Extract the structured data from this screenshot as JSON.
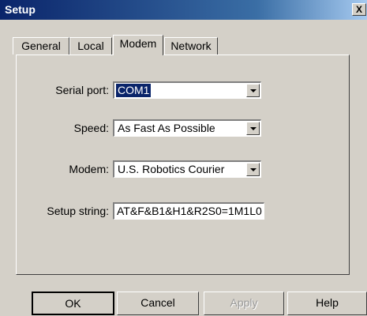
{
  "window": {
    "title": "Setup",
    "close_glyph": "X"
  },
  "tabs": [
    {
      "label": "General",
      "active": false
    },
    {
      "label": "Local",
      "active": false
    },
    {
      "label": "Modem",
      "active": true
    },
    {
      "label": "Network",
      "active": false
    }
  ],
  "form": {
    "serial_port": {
      "label": "Serial port:",
      "value": "COM1"
    },
    "speed": {
      "label": "Speed:",
      "value": "As Fast As Possible"
    },
    "modem": {
      "label": "Modem:",
      "value": "U.S. Robotics Courier"
    },
    "setup_string": {
      "label": "Setup string:",
      "value": "AT&F&B1&H1&R2S0=1M1L0"
    }
  },
  "buttons": {
    "ok": "OK",
    "cancel": "Cancel",
    "apply": "Apply",
    "help": "Help"
  },
  "colors": {
    "title_bar": "#0a246a",
    "selection": "#0a246a",
    "face": "#d4d0c8"
  }
}
